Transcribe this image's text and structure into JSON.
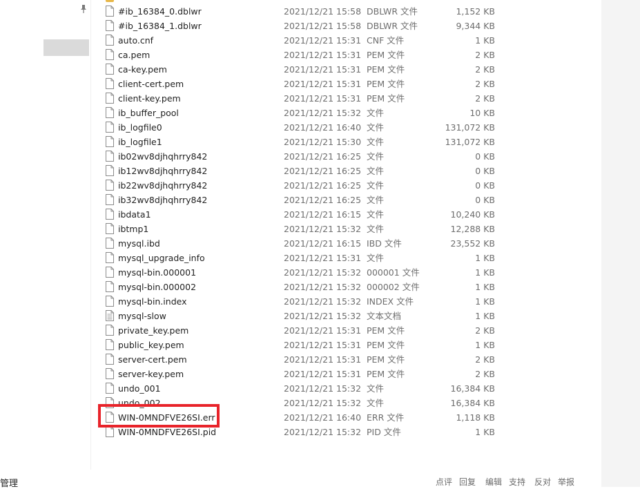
{
  "left_pane": {
    "pin_icon": "pin-icon"
  },
  "files": [
    {
      "name": "#ib_16384_0.dblwr",
      "date": "2021/12/21 15:58",
      "type": "DBLWR 文件",
      "size": "1,152 KB",
      "icon": "file-icon"
    },
    {
      "name": "#ib_16384_1.dblwr",
      "date": "2021/12/21 15:58",
      "type": "DBLWR 文件",
      "size": "9,344 KB",
      "icon": "file-icon"
    },
    {
      "name": "auto.cnf",
      "date": "2021/12/21 15:31",
      "type": "CNF 文件",
      "size": "1 KB",
      "icon": "file-icon"
    },
    {
      "name": "ca.pem",
      "date": "2021/12/21 15:31",
      "type": "PEM 文件",
      "size": "2 KB",
      "icon": "file-icon"
    },
    {
      "name": "ca-key.pem",
      "date": "2021/12/21 15:31",
      "type": "PEM 文件",
      "size": "2 KB",
      "icon": "file-icon"
    },
    {
      "name": "client-cert.pem",
      "date": "2021/12/21 15:31",
      "type": "PEM 文件",
      "size": "2 KB",
      "icon": "file-icon"
    },
    {
      "name": "client-key.pem",
      "date": "2021/12/21 15:31",
      "type": "PEM 文件",
      "size": "2 KB",
      "icon": "file-icon"
    },
    {
      "name": "ib_buffer_pool",
      "date": "2021/12/21 15:32",
      "type": "文件",
      "size": "10 KB",
      "icon": "file-icon"
    },
    {
      "name": "ib_logfile0",
      "date": "2021/12/21 16:40",
      "type": "文件",
      "size": "131,072 KB",
      "icon": "file-icon"
    },
    {
      "name": "ib_logfile1",
      "date": "2021/12/21 15:30",
      "type": "文件",
      "size": "131,072 KB",
      "icon": "file-icon"
    },
    {
      "name": "ib02wv8djhqhrry842",
      "date": "2021/12/21 16:25",
      "type": "文件",
      "size": "0 KB",
      "icon": "file-icon"
    },
    {
      "name": "ib12wv8djhqhrry842",
      "date": "2021/12/21 16:25",
      "type": "文件",
      "size": "0 KB",
      "icon": "file-icon"
    },
    {
      "name": "ib22wv8djhqhrry842",
      "date": "2021/12/21 16:25",
      "type": "文件",
      "size": "0 KB",
      "icon": "file-icon"
    },
    {
      "name": "ib32wv8djhqhrry842",
      "date": "2021/12/21 16:25",
      "type": "文件",
      "size": "0 KB",
      "icon": "file-icon"
    },
    {
      "name": "ibdata1",
      "date": "2021/12/21 16:15",
      "type": "文件",
      "size": "10,240 KB",
      "icon": "file-icon"
    },
    {
      "name": "ibtmp1",
      "date": "2021/12/21 15:32",
      "type": "文件",
      "size": "12,288 KB",
      "icon": "file-icon"
    },
    {
      "name": "mysql.ibd",
      "date": "2021/12/21 16:15",
      "type": "IBD 文件",
      "size": "23,552 KB",
      "icon": "file-icon"
    },
    {
      "name": "mysql_upgrade_info",
      "date": "2021/12/21 15:31",
      "type": "文件",
      "size": "1 KB",
      "icon": "file-icon"
    },
    {
      "name": "mysql-bin.000001",
      "date": "2021/12/21 15:32",
      "type": "000001 文件",
      "size": "1 KB",
      "icon": "file-icon"
    },
    {
      "name": "mysql-bin.000002",
      "date": "2021/12/21 15:32",
      "type": "000002 文件",
      "size": "1 KB",
      "icon": "file-icon"
    },
    {
      "name": "mysql-bin.index",
      "date": "2021/12/21 15:32",
      "type": "INDEX 文件",
      "size": "1 KB",
      "icon": "file-icon"
    },
    {
      "name": "mysql-slow",
      "date": "2021/12/21 15:32",
      "type": "文本文档",
      "size": "1 KB",
      "icon": "text-document-icon"
    },
    {
      "name": "private_key.pem",
      "date": "2021/12/21 15:31",
      "type": "PEM 文件",
      "size": "2 KB",
      "icon": "file-icon"
    },
    {
      "name": "public_key.pem",
      "date": "2021/12/21 15:31",
      "type": "PEM 文件",
      "size": "1 KB",
      "icon": "file-icon"
    },
    {
      "name": "server-cert.pem",
      "date": "2021/12/21 15:31",
      "type": "PEM 文件",
      "size": "2 KB",
      "icon": "file-icon"
    },
    {
      "name": "server-key.pem",
      "date": "2021/12/21 15:31",
      "type": "PEM 文件",
      "size": "2 KB",
      "icon": "file-icon"
    },
    {
      "name": "undo_001",
      "date": "2021/12/21 15:32",
      "type": "文件",
      "size": "16,384 KB",
      "icon": "file-icon"
    },
    {
      "name": "undo_002",
      "date": "2021/12/21 15:32",
      "type": "文件",
      "size": "16,384 KB",
      "icon": "file-icon"
    },
    {
      "name": "WIN-0MNDFVE26SI.err",
      "date": "2021/12/21 16:40",
      "type": "ERR 文件",
      "size": "1,118 KB",
      "icon": "file-icon"
    },
    {
      "name": "WIN-0MNDFVE26SI.pid",
      "date": "2021/12/21 15:32",
      "type": "PID 文件",
      "size": "1 KB",
      "icon": "file-icon"
    }
  ],
  "highlight": {
    "target": "WIN-0MNDFVE26SI.err",
    "color": "#e8232a"
  },
  "bottom_bar": {
    "left_label": "管理",
    "actions": [
      "点评",
      "回复",
      "编辑",
      "支持",
      "反对",
      "举报"
    ]
  }
}
